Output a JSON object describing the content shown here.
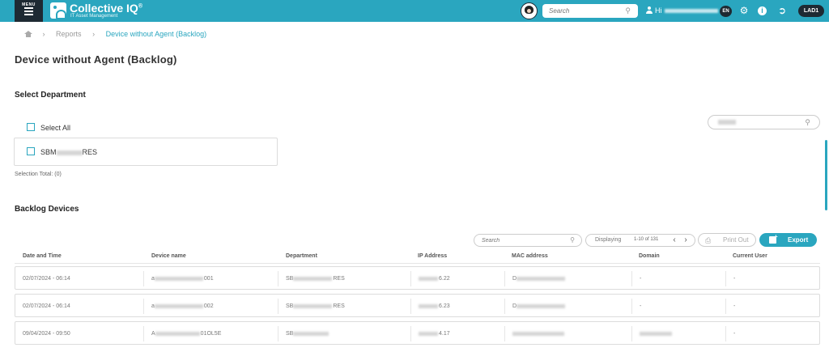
{
  "header": {
    "menu_label": "MENU",
    "brand": "Collective IQ",
    "brand_mark": "®",
    "brand_sub": "IT Asset Management",
    "search_placeholder": "Search",
    "greeting": "Hi",
    "language": "EN",
    "user_badge": "LAD1"
  },
  "breadcrumb": {
    "items": [
      "Reports"
    ],
    "current": "Device without Agent (Backlog)"
  },
  "page": {
    "title": "Device without Agent (Backlog)"
  },
  "department_section": {
    "title": "Select Department",
    "select_all_label": "Select All",
    "department_prefix": "SBM",
    "department_suffix": "RES",
    "selection_total": "Selection Total: (0)"
  },
  "backlog_section": {
    "title": "Backlog Devices",
    "search_placeholder": "Search",
    "displaying_label": "Displaying",
    "range_label": "1-10 of 131",
    "print_label": "Print Out",
    "export_label": "Export",
    "columns": [
      "Date and Time",
      "Device name",
      "Department",
      "IP Address",
      "MAC address",
      "Domain",
      "Current User"
    ],
    "rows": [
      {
        "date": "02/07/2024 - 06:14",
        "device_prefix": "a",
        "device_suffix": "001",
        "dept_prefix": "SB",
        "dept_suffix": "RES",
        "ip_suffix": "6.22",
        "mac_prefix": "D",
        "domain": "-",
        "user": "-"
      },
      {
        "date": "02/07/2024 - 06:14",
        "device_prefix": "a",
        "device_suffix": "002",
        "dept_prefix": "SB",
        "dept_suffix": "RES",
        "ip_suffix": "6.23",
        "mac_prefix": "D",
        "domain": "-",
        "user": "-"
      },
      {
        "date": "09/04/2024 - 09:50",
        "device_prefix": "A",
        "device_suffix": "01OL5E",
        "dept_prefix": "SB",
        "dept_suffix": "",
        "ip_suffix": "4.17",
        "mac_prefix": "",
        "domain": "",
        "user": "-"
      }
    ]
  },
  "colors": {
    "accent": "#2aa6bf",
    "dark": "#1e2a33"
  }
}
